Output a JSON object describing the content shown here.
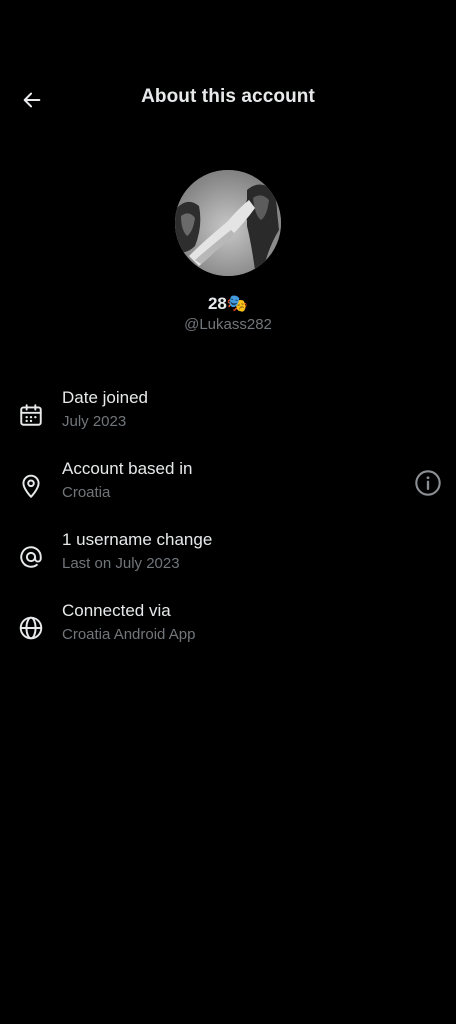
{
  "header": {
    "title": "About this account",
    "back_icon": "arrow-left-icon"
  },
  "profile": {
    "display_name": "28",
    "emoji": "🎭",
    "handle": "@Lukass282",
    "avatar_icon": "statue-photo"
  },
  "rows": [
    {
      "icon": "calendar-icon",
      "label": "Date joined",
      "value": "July 2023"
    },
    {
      "icon": "location-pin-icon",
      "label": "Account based in",
      "value": "Croatia",
      "action_icon": "info-icon"
    },
    {
      "icon": "at-sign-icon",
      "label": "1 username change",
      "value": "Last on July 2023"
    },
    {
      "icon": "globe-icon",
      "label": "Connected via",
      "value": "Croatia Android App"
    }
  ],
  "colors": {
    "background": "#000000",
    "primary_text": "#e7e9ea",
    "secondary_text": "#71767b"
  }
}
